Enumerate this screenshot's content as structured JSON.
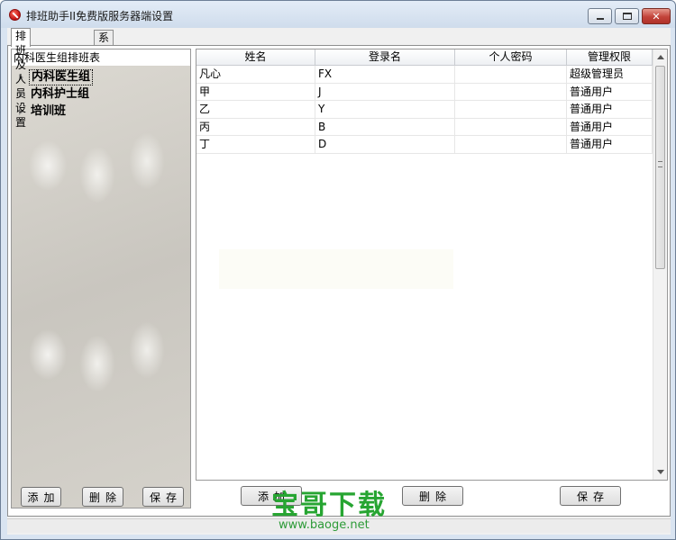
{
  "window": {
    "title": "排班助手II免费版服务器端设置"
  },
  "tabs": [
    {
      "label": "排班及人员设置",
      "active": true
    },
    {
      "label": "系统设置",
      "active": false
    }
  ],
  "left_pane": {
    "header": "内科医生组排班表",
    "tree": [
      {
        "label": "内科医生组",
        "selected": true
      },
      {
        "label": "内科护士组",
        "selected": false
      },
      {
        "label": "培训班",
        "selected": false
      }
    ]
  },
  "grid": {
    "columns": [
      "姓名",
      "登录名",
      "个人密码",
      "管理权限"
    ],
    "rows": [
      {
        "name": "凡心",
        "login": "FX",
        "password": "",
        "permission": "超级管理员"
      },
      {
        "name": "甲",
        "login": "J",
        "password": "",
        "permission": "普通用户"
      },
      {
        "name": "乙",
        "login": "Y",
        "password": "",
        "permission": "普通用户"
      },
      {
        "name": "丙",
        "login": "B",
        "password": "",
        "permission": "普通用户"
      },
      {
        "name": "丁",
        "login": "D",
        "password": "",
        "permission": "普通用户"
      }
    ]
  },
  "buttons": {
    "left_add": "添加",
    "left_delete": "删除",
    "left_save": "保存",
    "right_add": "添加",
    "right_delete": "删除",
    "right_save": "保存"
  },
  "watermark": {
    "text": "宝哥下载",
    "url": "www.baoge.net"
  },
  "colors": {
    "watermark_green": "#27a532",
    "close_button": "#c2433a"
  }
}
